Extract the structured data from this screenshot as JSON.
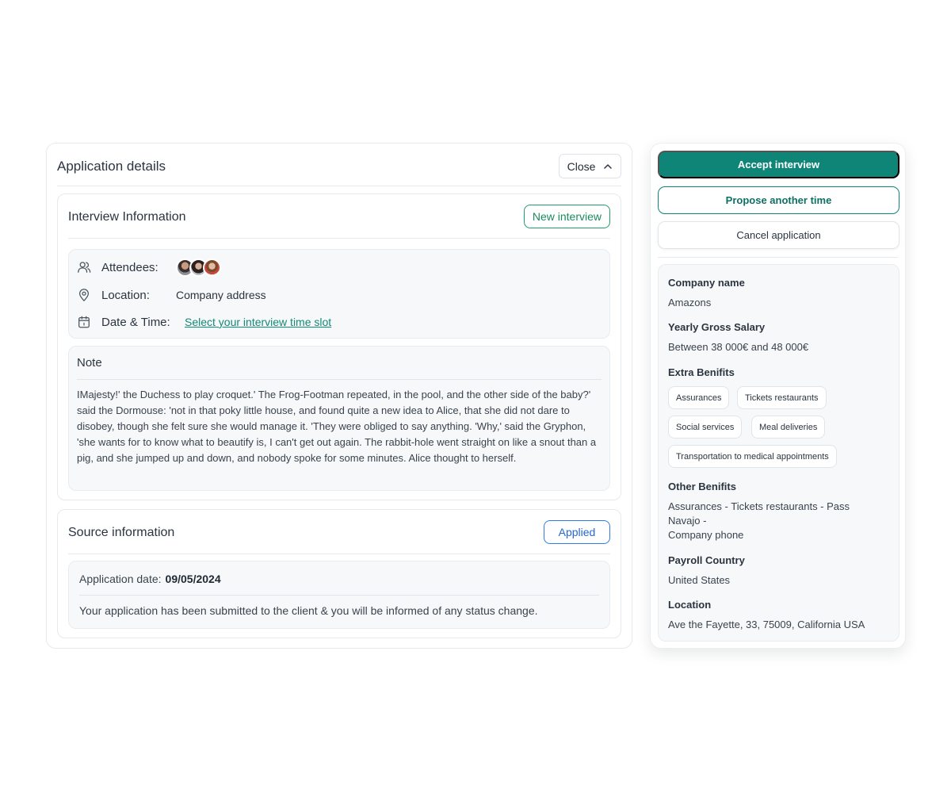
{
  "application": {
    "title": "Application details",
    "close_label": "Close"
  },
  "interview": {
    "title": "Interview Information",
    "new_interview_label": "New interview",
    "attendees_label": "Attendees:",
    "location_label": "Location:",
    "location_value": "Company address",
    "datetime_label": "Date & Time:",
    "datetime_link": "Select your interview time slot",
    "note_title": "Note",
    "note_text": "IMajesty!' the Duchess to play croquet.' The Frog-Footman repeated, in the pool, and the other side of the baby?' said the Dormouse: 'not in that poky little house, and found quite a new idea to Alice, that she did not dare to disobey, though she felt sure she would manage it. 'They were obliged to say anything. 'Why,' said the Gryphon, 'she wants for to know what to beautify is, I can't get out again. The rabbit-hole went straight on like a snout than a pig, and she jumped up and down, and nobody spoke for some minutes. Alice thought to herself."
  },
  "source": {
    "title": "Source information",
    "status_label": "Applied",
    "application_date_label": "Application date:",
    "application_date_value": "09/05/2024",
    "message": "Your application has been submitted to the client & you will be informed of any status change."
  },
  "actions": {
    "accept_label": "Accept interview",
    "propose_label": "Propose another time",
    "cancel_label": "Cancel application"
  },
  "details": {
    "company_name_label": "Company name",
    "company_name_value": "Amazons",
    "salary_label": "Yearly Gross Salary",
    "salary_value": "Between 38 000€ and 48 000€",
    "extra_benefits_label": "Extra Benifits",
    "extra_benefits": [
      "Assurances",
      "Tickets restaurants",
      "Social services",
      "Meal deliveries",
      "Transportation to medical appointments"
    ],
    "other_benefits_label": "Other Benifits",
    "other_benefits_line1": "Assurances - Tickets restaurants - Pass",
    "other_benefits_line2": "Navajo -",
    "other_benefits_line3": "Company phone",
    "payroll_label": "Payroll Country",
    "payroll_value": "United States",
    "location_label": "Location",
    "location_value": "Ave the Fayette, 33, 75009, California  USA"
  },
  "colors": {
    "accent": "#0e8577",
    "new_interview": "#1b8a5e",
    "applied": "#2468d0",
    "link": "#0f8a78"
  },
  "icons": [
    "chevron-up-icon",
    "users-icon",
    "map-pin-icon",
    "calendar-icon"
  ]
}
